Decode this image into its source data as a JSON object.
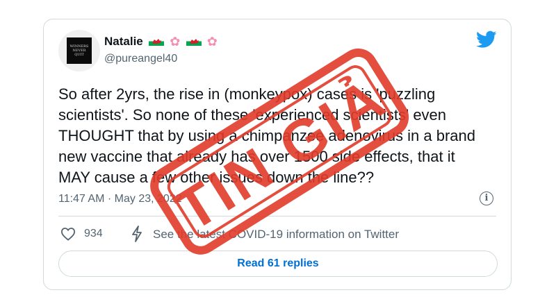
{
  "tweet": {
    "author_name": "Natalie",
    "handle": "@pureangel40",
    "avatar_text": "WINNERS\nNEVER\nQUIT",
    "text": "So after 2yrs, the rise in (monkeypox) cases is 'puzzling scientists'. So none of these 'experienced scientists' even THOUGHT that by using a chimpanzee adenovirus in a brand new vaccine that already has over 1500 side effects, that it MAY cause a few other issues down the line??",
    "time": "11:47 AM",
    "date": "May 23, 2022",
    "likes": "934",
    "covid_link": "See the latest COVID-19 information on Twitter",
    "replies_label": "Read 61 replies"
  },
  "stamp": {
    "text": "TIN GIẢ",
    "color": "#e23b2a"
  },
  "colors": {
    "twitter_blue": "#1d9bf0",
    "link_blue": "#006fd6",
    "secondary_text": "#536471",
    "border": "#cfd9de"
  }
}
